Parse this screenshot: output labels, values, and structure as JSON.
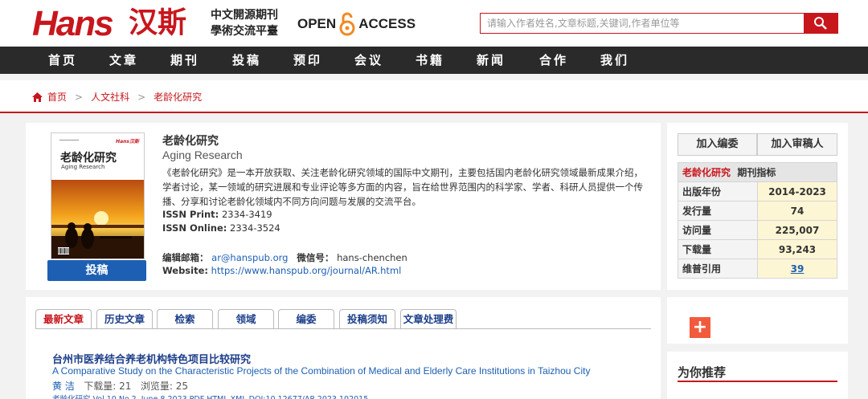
{
  "header": {
    "logo_en": "Hans",
    "logo_cn": "汉斯",
    "slogan_line1": "中文開源期刊",
    "slogan_line2": "學術交流平臺",
    "oa_left": "OPEN",
    "oa_right": "ACCESS",
    "search_placeholder": "请输入作者姓名,文章标题,关键词,作者单位等"
  },
  "nav": [
    "首页",
    "文章",
    "期刊",
    "投稿",
    "预印",
    "会议",
    "书籍",
    "新闻",
    "合作",
    "我们"
  ],
  "breadcrumb": [
    "首页",
    "人文社科",
    "老龄化研究"
  ],
  "journal": {
    "cover_title": "老龄化研究",
    "cover_sub": "Aging Research",
    "cover_brand": "Hans汉斯",
    "title": "老龄化研究",
    "title_en": "Aging Research",
    "description": "《老龄化研究》是一本开放获取、关注老龄化研究领域的国际中文期刊，主要包括国内老龄化研究领域最新成果介绍，学者讨论，某一领域的研究进展和专业评论等多方面的内容，旨在给世界范围内的科学家、学者、科研人员提供一个传播、分享和讨论老龄化领域内不同方向问题与发展的交流平台。",
    "issn_print_label": "ISSN Print:",
    "issn_print": "2334-3419",
    "issn_online_label": "ISSN Online:",
    "issn_online": "2334-3524",
    "email_label": "编辑邮箱：",
    "email": "ar@hanspub.org",
    "wechat_label": "微信号：",
    "wechat": "hans-chenchen",
    "website_label": "Website:",
    "website": "https://www.hanspub.org/journal/AR.html",
    "submit_label": "投稿"
  },
  "side": {
    "btn_editorial": "加入编委",
    "btn_reviewer": "加入审稿人",
    "metrics_title_red": "老龄化研究",
    "metrics_title": "期刊指标",
    "metrics": [
      {
        "label": "出版年份",
        "value": "2014-2023"
      },
      {
        "label": "发行量",
        "value": "74"
      },
      {
        "label": "访问量",
        "value": "225,007"
      },
      {
        "label": "下载量",
        "value": "93,243"
      },
      {
        "label": "维普引用",
        "value": "39"
      }
    ],
    "plus": "+",
    "recommend": "为你推荐"
  },
  "tabs": [
    "最新文章",
    "历史文章",
    "检索",
    "领域",
    "编委",
    "投稿须知",
    "文章处理费"
  ],
  "article": {
    "title": "台州市医养结合养老机构特色项目比较研究",
    "title_en": "A Comparative Study on the Characteristic Projects of the Combination of Medical and Elderly Care Institutions in Taizhou City",
    "authors": "黄 洁",
    "downloads_label": "下载量:",
    "downloads": "21",
    "views_label": "浏览量:",
    "views": "25",
    "citation": "老龄化研究 Vol.10 No.2, June 8 2023  PDF  HTML  XML  DOI:10.12677/AR.2023.102015"
  }
}
